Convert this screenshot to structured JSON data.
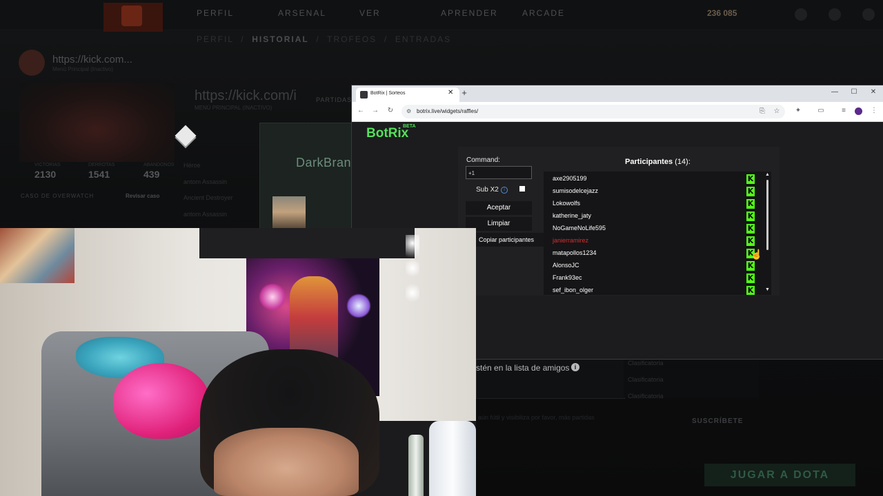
{
  "dota": {
    "nav": [
      "PERFIL",
      "ARSENAL",
      "VER",
      "APRENDER",
      "ARCADE"
    ],
    "currency": "236 085",
    "subnav": {
      "perfil": "PERFIL",
      "historial": "HISTORIAL",
      "trofeos": "TROFEOS",
      "entradas": "ENTRADAS"
    },
    "profile_name": "https://kick.com...",
    "profile_sub": "Menú Principal (Inactivo)",
    "profile_right_name": "https://kick.com/i",
    "profile_right_sub": "MENÚ PRINCIPAL (INACTIVO)",
    "partidas": "PARTIDAS",
    "stats": [
      {
        "value": "2130",
        "label": "VICTORIAS"
      },
      {
        "value": "1541",
        "label": "DERROTAS"
      },
      {
        "value": "439",
        "label": "ABANDONOS"
      }
    ],
    "overwatch": "CASO DE OVERWATCH",
    "overwatch_btn": "Revisar caso",
    "matches": [
      "Héroe",
      "antom Assassin",
      "Ancient Destroyer",
      "antom Assassin"
    ],
    "darkbrand": "DarkBran",
    "friends_text": "stén en la lista de amigos",
    "clasificatoria": [
      "Clasificatoria",
      "Clasificatoria",
      "Clasificatoria"
    ],
    "faint_text": "aún fútil y visibiliza por favor, más partidas",
    "suscribete": "SUSCRÍBETE",
    "jugar": "JUGAR A DOTA"
  },
  "chrome": {
    "tab_title": "BotRix | Sorteos",
    "url": "botrix.live/widgets/raffles/",
    "window_controls": [
      "—",
      "☐",
      "✕"
    ]
  },
  "botrix": {
    "logo": "BotRix",
    "beta": "BETA",
    "command_label": "Command:",
    "command_value": "+1",
    "sub_x2_label": "Sub X2",
    "accept_label": "Aceptar",
    "clear_label": "Limpiar",
    "copy_label": "Copiar participantes",
    "participants_title": "Participantes",
    "participants_count": "(14):",
    "participants": [
      {
        "name": "axe2905199",
        "winner": false
      },
      {
        "name": "sumisodelcejazz",
        "winner": false
      },
      {
        "name": "Lokowolfs",
        "winner": false
      },
      {
        "name": "katherine_jaty",
        "winner": false
      },
      {
        "name": "NoGameNoLife595",
        "winner": false
      },
      {
        "name": "janierramirez",
        "winner": true
      },
      {
        "name": "matapollos1234",
        "winner": false
      },
      {
        "name": "AlonsoJC",
        "winner": false
      },
      {
        "name": "Frank93ec",
        "winner": false
      },
      {
        "name": "sef_ibon_olger",
        "winner": false
      }
    ],
    "platform_icon": "kick-logo-icon",
    "colors": {
      "brand": "#53e05a",
      "kick": "#53fc18",
      "winner": "#d32f2f"
    }
  }
}
